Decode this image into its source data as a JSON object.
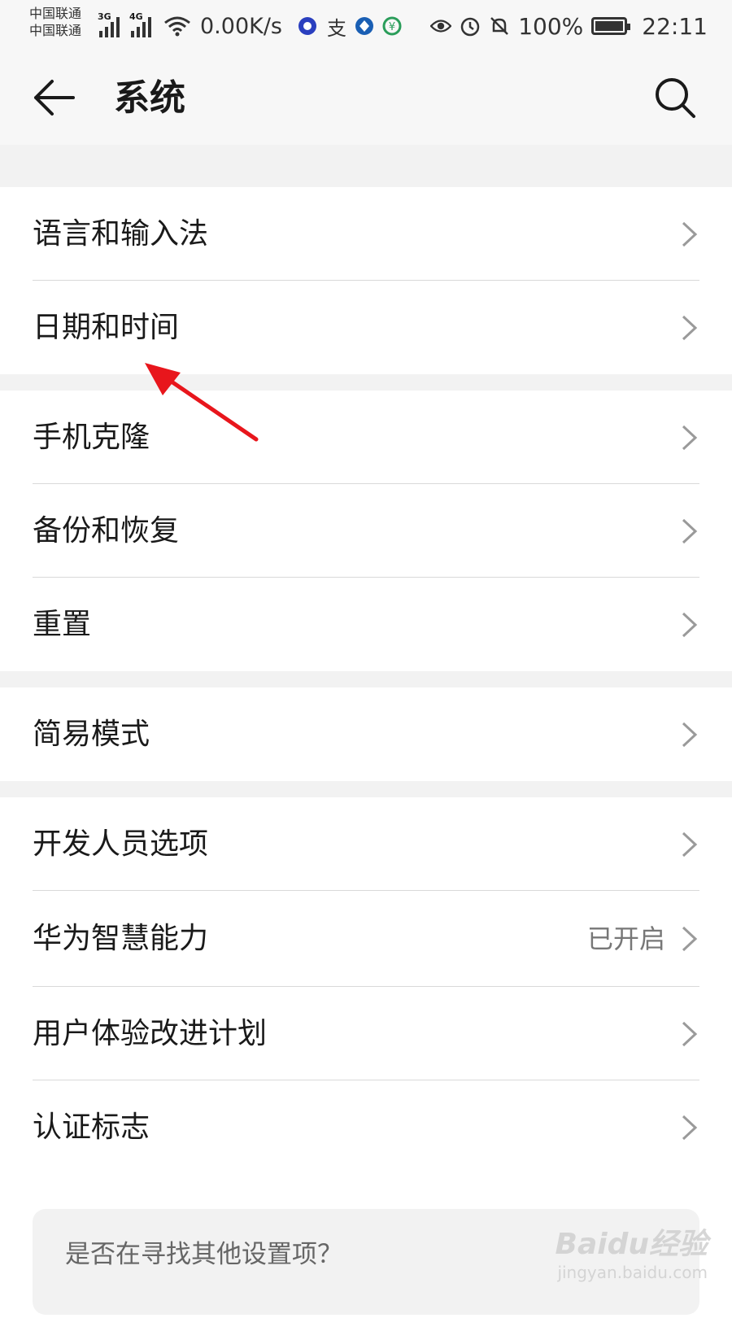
{
  "status": {
    "carrier_line1": "中国联通",
    "carrier_line2": "中国联通",
    "net1": "3G",
    "net2": "4G",
    "speed": "0.00K/s",
    "battery": "100%",
    "time": "22:11"
  },
  "header": {
    "title": "系统"
  },
  "groups": {
    "g1": [
      "语言和输入法",
      "日期和时间"
    ],
    "g2": [
      "手机克隆",
      "备份和恢复",
      "重置"
    ],
    "g3": [
      "简易模式"
    ],
    "g4": [
      "开发人员选项",
      "华为智慧能力",
      "用户体验改进计划",
      "认证标志"
    ]
  },
  "values": {
    "huawei_ai_status": "已开启"
  },
  "suggestion": {
    "text": "是否在寻找其他设置项？"
  },
  "watermark": {
    "brand": "Baidu经验",
    "url": "jingyan.baidu.com"
  },
  "colors": {
    "annotation_arrow": "#e8161c"
  }
}
